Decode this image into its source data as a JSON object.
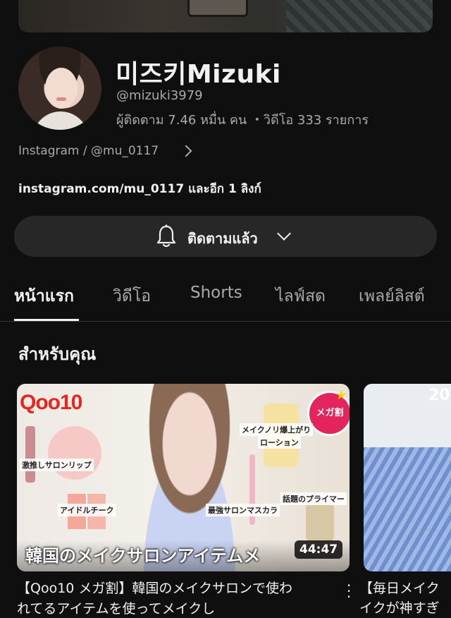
{
  "channel": {
    "name": "미즈키Mizuki",
    "handle": "@mizuki3979",
    "stats": "ผู้ติดตาม 7.46 หมื่น คน ・วิดีโอ 333 รายการ",
    "link_summary": "Instagram / @mu_0117",
    "external_link": "instagram.com/mu_0117",
    "external_more": "และอีก 1 ลิงก์"
  },
  "subscribe": {
    "label": "ติดตามแล้ว"
  },
  "tabs": [
    {
      "label": "หน้าแรก"
    },
    {
      "label": "วิดีโอ"
    },
    {
      "label": "Shorts"
    },
    {
      "label": "ไลฟ์สด"
    },
    {
      "label": "เพลย์ลิสต์"
    }
  ],
  "section": {
    "title": "สำหรับคุณ"
  },
  "videos": [
    {
      "thumb_logo": "Qoo10",
      "thumb_badge": "メガ割",
      "thumb_labels": [
        "激推しサロンリップ",
        "メイクノリ爆上がり",
        "ローション",
        "アイドルチーク",
        "最強サロンマスカラ",
        "話題のプライマー"
      ],
      "thumb_headline": "韓国のメイクサロンアイテムメ",
      "duration": "44:47",
      "title_line1": "【Qoo10 メガ割】韓国のメイクサロンで使わ",
      "title_line2": "れてるアイテムを使ってメイクし"
    },
    {
      "thumb_year": "20",
      "title_line1": "【毎日メイク",
      "title_line2": "イクが神すぎ"
    }
  ]
}
